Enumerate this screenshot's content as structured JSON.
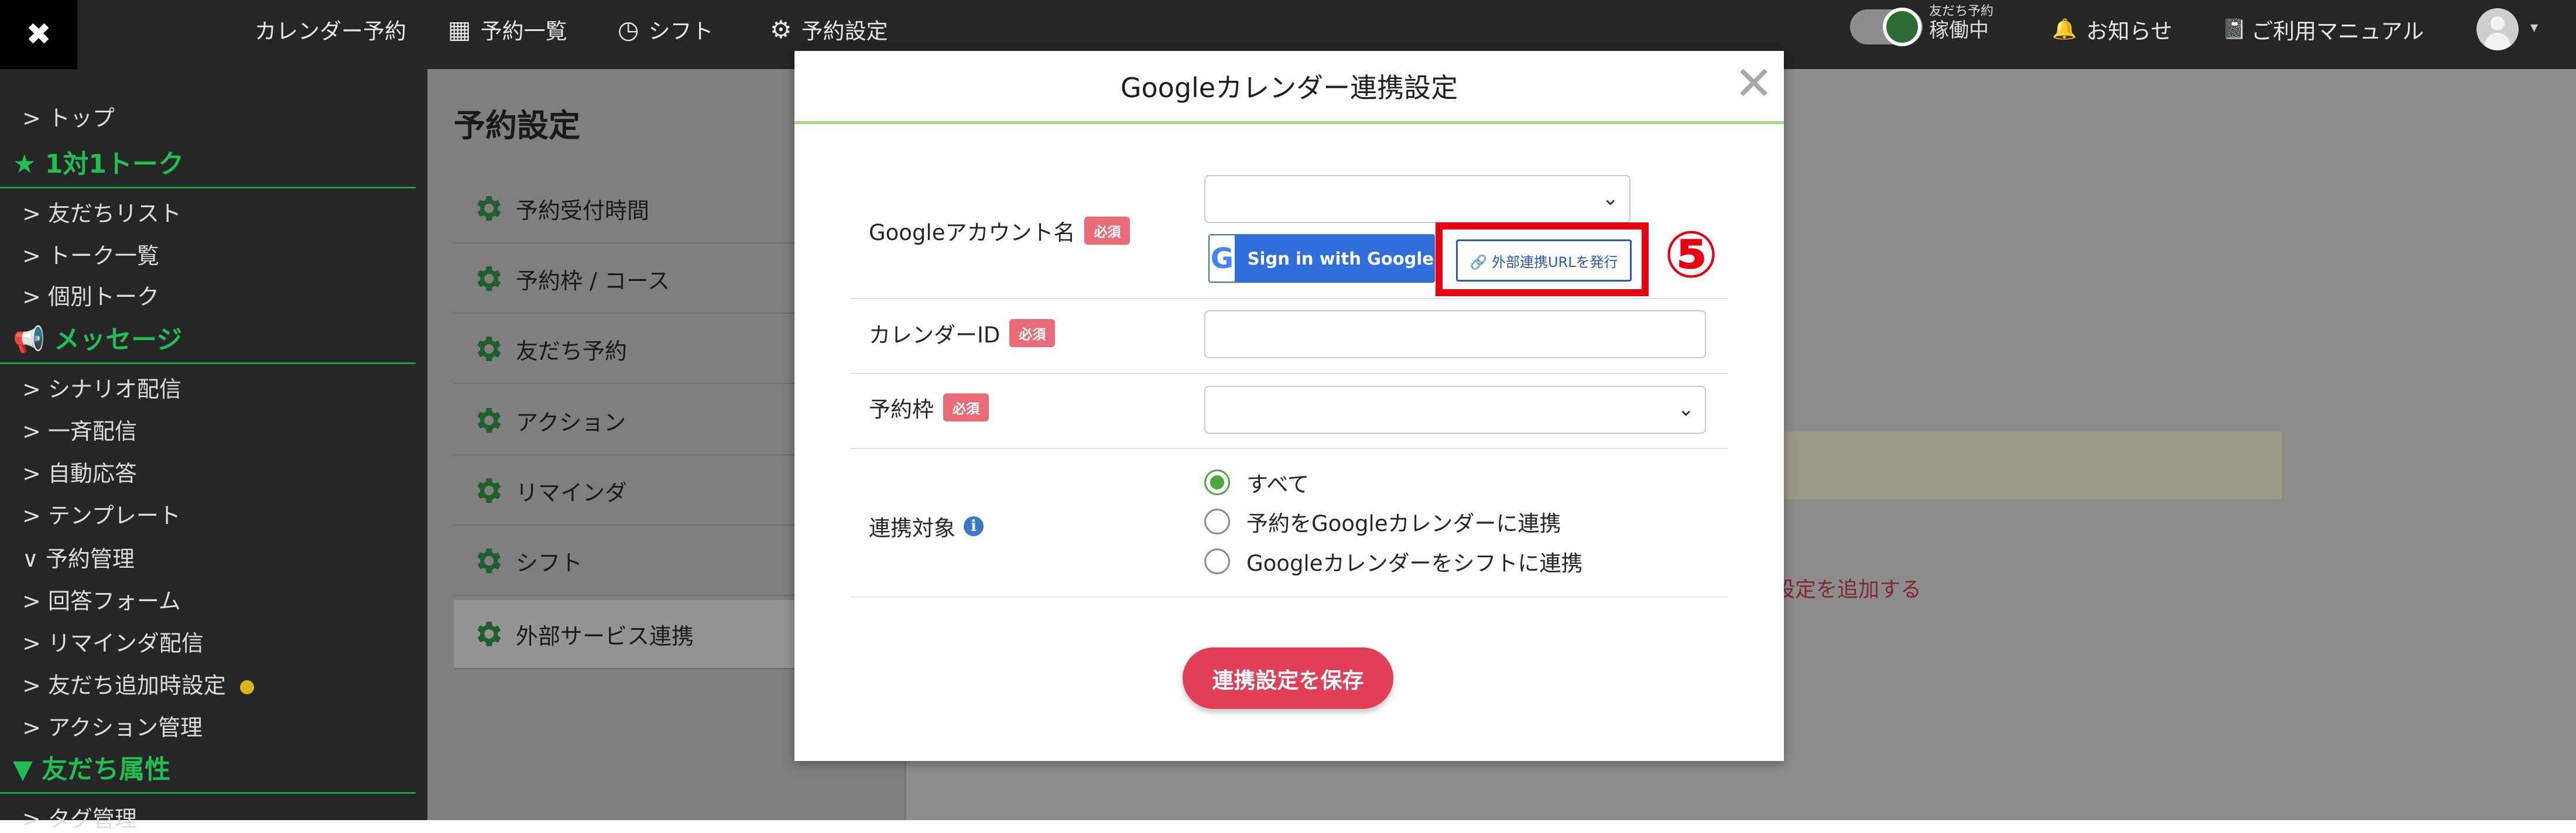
{
  "topnav": {
    "close": "✖",
    "items": [
      {
        "label": "カレンダー予約",
        "icon": ""
      },
      {
        "label": "予約一覧",
        "icon": "▦"
      },
      {
        "label": "シフト",
        "icon": "◷"
      },
      {
        "label": "予約設定",
        "icon": "⚙"
      }
    ],
    "toggle_small": "友だち予約",
    "toggle_status": "稼働中",
    "notifications": "お知らせ",
    "notifications_icon": "🔔",
    "manual": "ご利用マニュアル",
    "manual_icon": "📓",
    "avatar_caret": "▾"
  },
  "sidebar": {
    "top": "> トップ",
    "section1": "★ 1対1トーク",
    "s1_items": [
      "> 友だちリスト",
      "> トーク一覧",
      "> 個別トーク"
    ],
    "section2": "📢 メッセージ",
    "s2_items": [
      "> シナリオ配信",
      "> 一斉配信",
      "> 自動応答",
      "> テンプレート",
      "∨ 予約管理",
      "> 回答フォーム",
      "> リマインダ配信",
      "> 友だち追加時設定",
      "> アクション管理"
    ],
    "section3": "▼ 友だち属性",
    "s3_items": [
      "> タグ管理"
    ]
  },
  "page": {
    "title": "予約設定",
    "menu": [
      "予約受付時間",
      "予約枠 / コース",
      "友だち予約",
      "アクション",
      "リマインダ",
      "シフト",
      "外部サービス連携"
    ],
    "link_fragment": "設定を追加する"
  },
  "modal": {
    "title": "Googleカレンダー連携設定",
    "close": "✕",
    "required": "必須",
    "google_account_label": "Googleアカウント名",
    "google_account_value": "",
    "signin_logo": "G",
    "signin_label": "Sign in with Google",
    "external_url_label": "🔗 外部連携URLを発行",
    "step_marker": "⑤",
    "calendar_id_label": "カレンダーID",
    "calendar_id_value": "",
    "slot_label": "予約枠",
    "slot_value": "",
    "target_label": "連携対象",
    "target_info_icon": "i",
    "options": [
      "すべて",
      "予約をGoogleカレンダーに連携",
      "Googleカレンダーをシフトに連携"
    ],
    "selected_option": "すべて",
    "save_label": "連携設定を保存"
  },
  "colors": {
    "accent_green": "#1fbf53",
    "modal_header_border": "#a6d78f",
    "required_badge": "#e96b78",
    "save_button": "#e23e58",
    "google_blue": "#2f6edb",
    "annotation_red": "#e60012"
  }
}
